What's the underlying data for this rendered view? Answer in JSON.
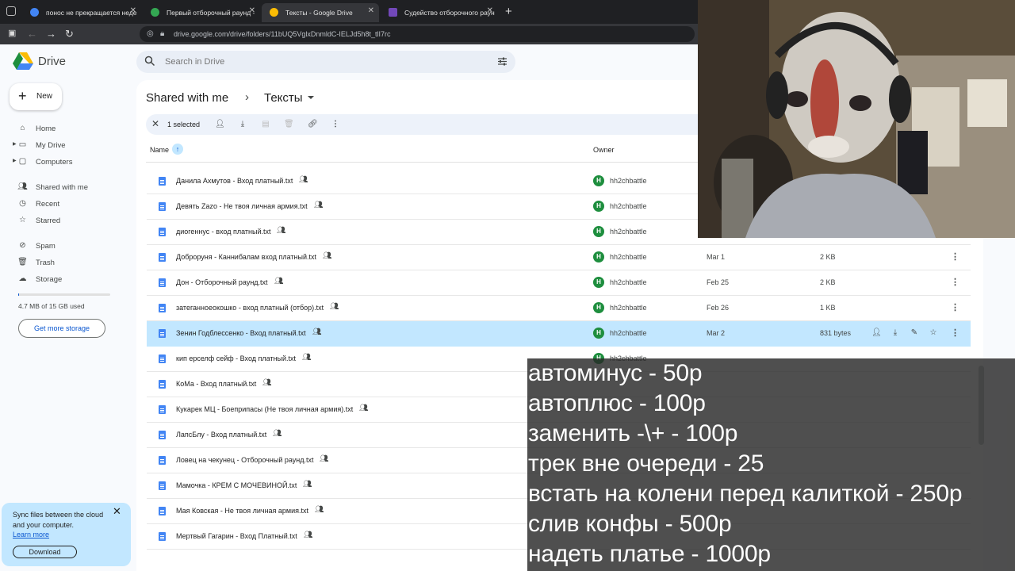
{
  "browser": {
    "tabs": [
      {
        "title": "понос не прекращается неде",
        "favicon_color": "#4285f4",
        "active": false
      },
      {
        "title": "Первый отборочный раунд -",
        "favicon_color": "#34a853",
        "active": false
      },
      {
        "title": "Тексты - Google Drive",
        "favicon_color": "#fbbc04",
        "active": true
      },
      {
        "title": "Судейство отборочного раун",
        "favicon_color": "#7248b9",
        "active": false
      }
    ],
    "url": "drive.google.com/drive/folders/11bUQ5VglxDnmldC-IELJd5h8t_tlI7rc"
  },
  "drive": {
    "app_name": "Drive",
    "search_placeholder": "Search in Drive",
    "new_label": "New",
    "nav": [
      {
        "label": "Home",
        "icon": "home-icon"
      },
      {
        "label": "My Drive",
        "icon": "my-drive-icon"
      },
      {
        "label": "Computers",
        "icon": "computers-icon"
      },
      {
        "label": "Shared with me",
        "icon": "shared-icon"
      },
      {
        "label": "Recent",
        "icon": "recent-icon"
      },
      {
        "label": "Starred",
        "icon": "star-icon"
      },
      {
        "label": "Spam",
        "icon": "spam-icon"
      },
      {
        "label": "Trash",
        "icon": "trash-icon"
      },
      {
        "label": "Storage",
        "icon": "cloud-icon"
      }
    ],
    "storage_used": "4.7 MB of 15 GB used",
    "storage_fraction": 0.0003,
    "get_storage_label": "Get more storage",
    "promo": {
      "text": "Sync files between the cloud and your computer.",
      "link": "Learn more",
      "button": "Download"
    },
    "breadcrumb": {
      "parent": "Shared with me",
      "current": "Тексты"
    },
    "selection": {
      "count_label": "1 selected"
    },
    "columns": {
      "name": "Name",
      "owner": "Owner"
    },
    "files": [
      {
        "name": "Данила Ахмутов - Вход платный.txt",
        "owner": "hh2chbattle",
        "date": "",
        "size": ""
      },
      {
        "name": "Девять Zazo - Не твоя личная армия.txt",
        "owner": "hh2chbattle",
        "date": "",
        "size": ""
      },
      {
        "name": "диогеннус - вход платный.txt",
        "owner": "hh2chbattle",
        "date": "",
        "size": ""
      },
      {
        "name": "Доброруня - Каннибалам вход платный.txt",
        "owner": "hh2chbattle",
        "date": "Mar 1",
        "size": "2 KB"
      },
      {
        "name": "Дон - Отборочный раунд.txt",
        "owner": "hh2chbattle",
        "date": "Feb 25",
        "size": "2 KB"
      },
      {
        "name": "затеганноеокошко - вход платный (отбор).txt",
        "owner": "hh2chbattle",
        "date": "Feb 26",
        "size": "1 KB"
      },
      {
        "name": "Зенин Годблессенко - Вход платный.txt",
        "owner": "hh2chbattle",
        "date": "Mar 2",
        "size": "831 bytes",
        "selected": true
      },
      {
        "name": "кип ерселф сейф - Вход платный.txt",
        "owner": "hh2chbattle",
        "date": "",
        "size": ""
      },
      {
        "name": "КоМа - Вход платный.txt",
        "owner": "",
        "date": "",
        "size": ""
      },
      {
        "name": "Кукарек МЦ - Боеприпасы (Не твоя личная армия).txt",
        "owner": "",
        "date": "",
        "size": ""
      },
      {
        "name": "ЛапсБлу - Вход платный.txt",
        "owner": "",
        "date": "",
        "size": ""
      },
      {
        "name": "Ловец на чекунец - Отборочный раунд.txt",
        "owner": "",
        "date": "",
        "size": ""
      },
      {
        "name": "Мамочка - КРЕМ С МОЧЕВИНОЙ.txt",
        "owner": "",
        "date": "",
        "size": ""
      },
      {
        "name": "Мая Ковская - Не твоя личная армия.txt",
        "owner": "",
        "date": "",
        "size": ""
      },
      {
        "name": "Мертвый Гагарин - Вход Платный.txt",
        "owner": "",
        "date": "",
        "size": ""
      }
    ]
  },
  "overlay_lines": [
    "автоминус - 50р",
    "автоплюс - 100р",
    "заменить -\\+ - 100р",
    "трек вне очереди - 25",
    "встать на колени перед калиткой - 250р",
    "слив конфы - 500р",
    "надеть платье - 1000р"
  ]
}
